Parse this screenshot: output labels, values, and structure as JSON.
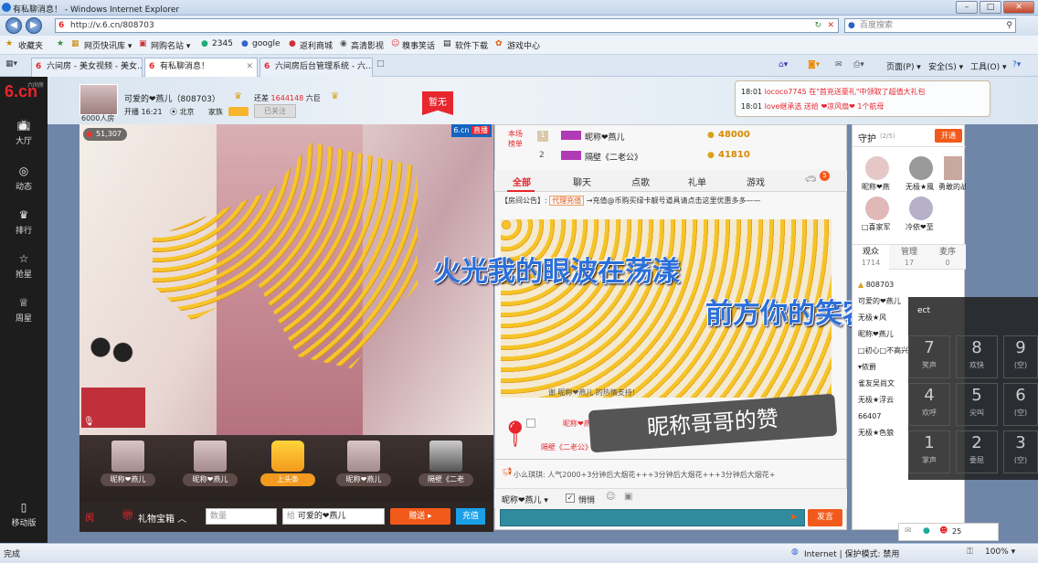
{
  "window": {
    "title": "有私聊消息！ - Windows Internet Explorer"
  },
  "browser": {
    "address": "http://v.6.cn/808703",
    "search_placeholder": "百度搜索",
    "favorites": [
      "收藏夹",
      "网页快讯库 ▾",
      "网购名站 ▾",
      "2345",
      "google",
      "返利商城",
      "高清影视",
      "糗事笑话",
      "软件下载",
      "游戏中心"
    ],
    "tabs": [
      {
        "label": "六间房 - 美女视频 - 美女..."
      },
      {
        "label": "有私聊消息！"
      },
      {
        "label": "六间房后台管理系统 - 六..."
      }
    ],
    "commands": [
      "页面(P) ▾",
      "安全(S) ▾",
      "工具(O) ▾"
    ]
  },
  "sidebar": {
    "logo": "6.cn",
    "logo_sub": "六间房",
    "items": [
      "大厅",
      "动态",
      "排行",
      "抢星",
      "周星"
    ],
    "bottom": "移动版"
  },
  "host": {
    "name": "可爱的❤燕儿（808703）",
    "fans": "6000人房",
    "live_time": "开播 16:21",
    "city": "北京",
    "family_label": "家族",
    "follow": "已关注",
    "level_label": "还差",
    "need": "1644148",
    "rank_title": "六巨",
    "temp_badge": "暂无",
    "viewers": "51,307"
  },
  "ticker": {
    "lines": [
      {
        "time": "18:01",
        "text": "lococo7745 在\"首充送豪礼\"中领取了超值大礼包"
      },
      {
        "time": "18:01",
        "text": "love继承选 送给 ❤̶凉风扇❤ 1个航母"
      }
    ]
  },
  "rank": {
    "label": "本场榜单",
    "rows": [
      {
        "no": "1",
        "name": "昵称❤燕儿",
        "value": "48000"
      },
      {
        "no": "2",
        "name": "隔壁《二老公》",
        "value": "41810"
      }
    ]
  },
  "chat": {
    "tabs": [
      "全部",
      "聊天",
      "点歌",
      "礼单",
      "游戏"
    ],
    "tab_badge": "5",
    "room_direct": "直播",
    "room_brand": "6.cn",
    "notice_label": "【房间公告】:",
    "notice_link": "代理充值",
    "notice_text": "→充值@币购买绿卡靓号道具请点击这里优惠多多——",
    "thanks": "谢 昵称❤燕儿 的热情支持!",
    "line1": "昵称❤燕儿",
    "line2": "隔壁《二老公》",
    "horn": "小么琪琪: 人气2000+3分钟后大烟花+++3分钟后大烟花+++3分钟后大烟花+",
    "target": "昵称❤燕儿",
    "whisper": "悄悄",
    "send": "发言"
  },
  "overlay": {
    "line1": "火光我的眼波在荡漾",
    "line2": "前方你的笑容在荡漾",
    "praise": "昵称哥哥的赞"
  },
  "gifts": {
    "items": [
      "昵称❤燕儿",
      "昵称❤燕儿",
      "上头条",
      "昵称❤燕儿",
      "隔壁《二老"
    ],
    "box": "礼物宝箱",
    "qty_placeholder": "数量",
    "to_label": "给",
    "to": "可爱的❤燕儿",
    "give": "赠送",
    "recharge": "充值"
  },
  "guard": {
    "title": "守护",
    "count": "(2/5)",
    "open": "开通",
    "members": [
      "昵称❤燕",
      "无极★風",
      "勇敢的战",
      "□喜家军",
      "冷依❤至"
    ]
  },
  "audience": {
    "tabs": [
      {
        "label": "观众",
        "count": "1714"
      },
      {
        "label": "管理",
        "count": "17"
      },
      {
        "label": "麦序",
        "count": "0"
      }
    ],
    "list": [
      "808703",
      "可爱的❤燕儿",
      "无极★风",
      "昵称❤燕儿",
      "□初心□不高兴",
      "▾侬爵",
      "雀友吴尚文",
      "无极★浮云",
      "66407",
      "无极★色狼"
    ],
    "bottom_count": "25"
  },
  "keypad": {
    "top_label": "ect",
    "keys": [
      {
        "n": "7",
        "l": "笑声"
      },
      {
        "n": "8",
        "l": "欢快"
      },
      {
        "n": "9",
        "l": "(空)"
      },
      {
        "n": "4",
        "l": "欢呼"
      },
      {
        "n": "5",
        "l": "尖叫"
      },
      {
        "n": "6",
        "l": "(空)"
      },
      {
        "n": "1",
        "l": "掌声"
      },
      {
        "n": "2",
        "l": "委屈"
      },
      {
        "n": "3",
        "l": "(空)"
      }
    ]
  },
  "status": {
    "left": "完成",
    "zone": "Internet | 保护模式: 禁用",
    "zoom": "100%"
  }
}
